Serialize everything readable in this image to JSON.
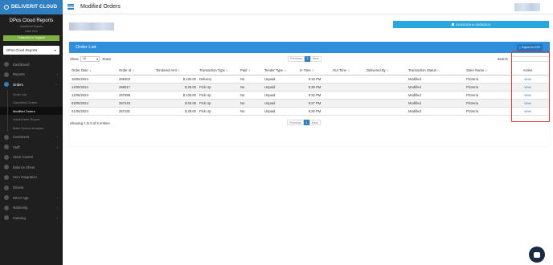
{
  "brand": {
    "name": "DELIVERIT CLOUD"
  },
  "header": {
    "title": "Modified Orders"
  },
  "sidebar": {
    "title": "DPos Cloud Reports",
    "subtitle": "Dashboard Reports",
    "subtitle2": "Learn Here",
    "green_button": "Subscribe to Support",
    "select_value": "DPos Cloud Reports",
    "items": [
      {
        "label": "Dashboard"
      },
      {
        "label": "Reports"
      },
      {
        "label": "Orders"
      },
      {
        "label": "Customers"
      },
      {
        "label": "Staff"
      },
      {
        "label": "Stock Control"
      },
      {
        "label": "Balance Sheet"
      },
      {
        "label": "Xero Integration"
      },
      {
        "label": "Drivers"
      },
      {
        "label": "Driver App"
      },
      {
        "label": "Marketing"
      },
      {
        "label": "Catering"
      }
    ],
    "order_subitems": [
      {
        "label": "Order List"
      },
      {
        "label": "Cancelled Orders"
      },
      {
        "label": "Modified Orders"
      },
      {
        "label": "Voided Item Report"
      },
      {
        "label": "Maint Screen Analysis"
      }
    ]
  },
  "date_range": {
    "label": "01/05/2024 to 18/05/2024"
  },
  "panel": {
    "title": "Order List",
    "export_label": "Export to CSV",
    "show_label": "Show",
    "show_value": "10",
    "rows_label": "Rows",
    "search_label": "Search",
    "prev_label": "Previous",
    "next_label": "Next",
    "page": "1",
    "info": "Showing 1 to 5 of 5 entries"
  },
  "table": {
    "headers": [
      "Order Date",
      "Order Id",
      "Tendered Amt",
      "Transaction Type",
      "Paid",
      "Tender Type",
      "In Time",
      "Out Time",
      "Delivered By",
      "Transaction Status",
      "Store Name",
      "Action"
    ],
    "rows": [
      [
        "18/05/2024",
        "258303",
        "$ 130.00",
        "Delivery",
        "No",
        "Unpaid",
        "5:16 PM",
        "",
        "",
        "Modified",
        "Pizzeria ",
        "view"
      ],
      [
        "14/05/2024",
        "258017",
        "$ 25.00",
        "Pick Up",
        "No",
        "Unpaid",
        "5:38 PM",
        "",
        "",
        "Modified",
        "Pizzeria ",
        "view"
      ],
      [
        "12/05/2024",
        "257999",
        "$ 130.00",
        "Pick Up",
        "No",
        "Unpaid",
        "6:32 PM",
        "",
        "",
        "Modified",
        "Pizzeria ",
        "view"
      ],
      [
        "03/05/2024",
        "257243",
        "$ 63.00",
        "Pick Up",
        "No",
        "Unpaid",
        "5:27 PM",
        "",
        "",
        "Modified",
        "Pizzeria ",
        "view"
      ],
      [
        "01/05/2024",
        "257191",
        "$ 29.00",
        "Pick Up",
        "No",
        "Unpaid",
        "6:26 PM",
        "",
        "",
        "Modified",
        "Pizzeria ",
        "view"
      ]
    ]
  },
  "colors": {
    "brand_blue": "#2f7fc1",
    "panel_blue": "#2f8fdc",
    "date_blue": "#29a8e0",
    "highlight_red": "#e53935",
    "sidebar_bg": "#1f1f1f"
  }
}
